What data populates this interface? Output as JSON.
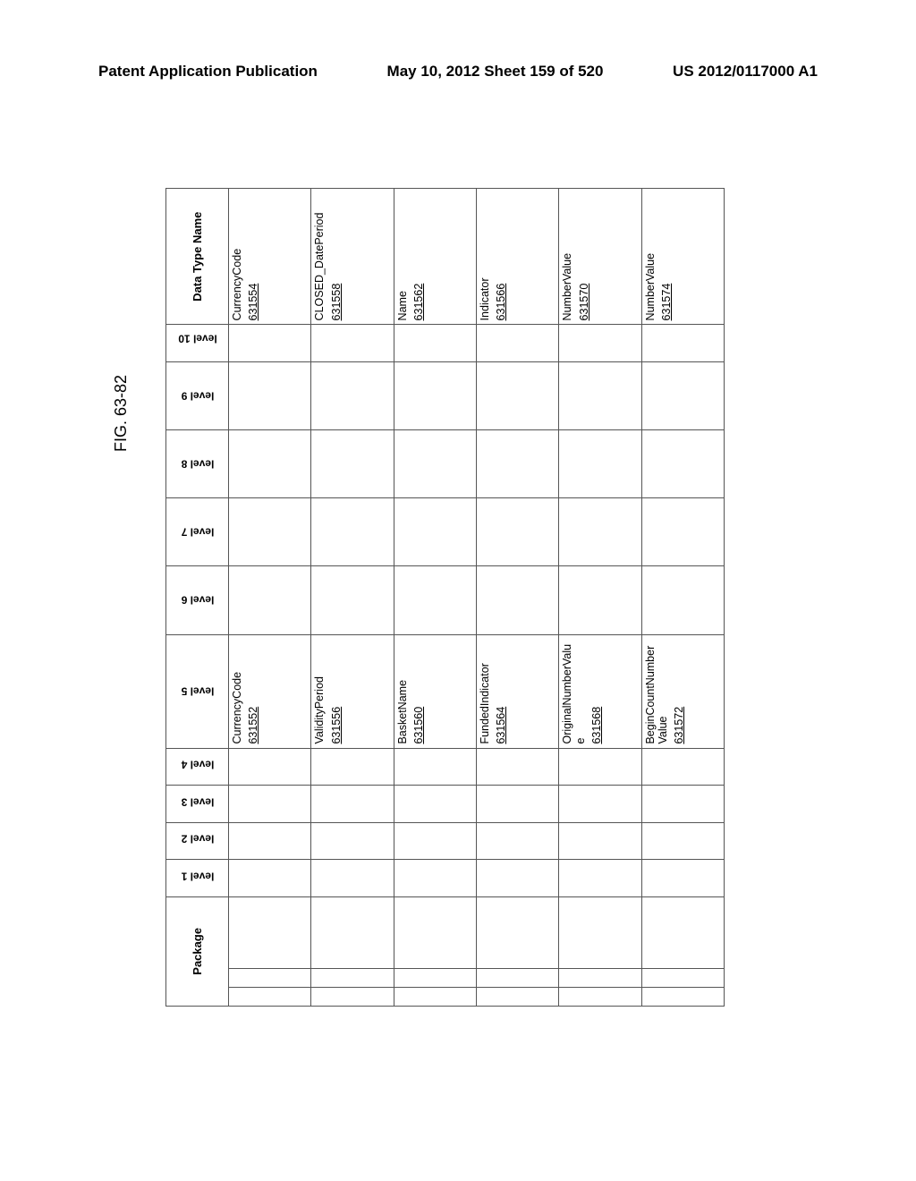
{
  "header": {
    "left": "Patent Application Publication",
    "center": "May 10, 2012  Sheet 159 of 520",
    "right": "US 2012/0117000 A1"
  },
  "figure_label": "FIG. 63-82",
  "columns": {
    "package": "Package",
    "level1": "level 1",
    "level2": "level 2",
    "level3": "level 3",
    "level4": "level 4",
    "level5": "level 5",
    "level6": "level 6",
    "level7": "level 7",
    "level8": "level 8",
    "level9": "level 9",
    "level10": "level 10",
    "datatype": "Data Type Name"
  },
  "rows": [
    {
      "level5": "CurrencyCode",
      "level5_ref": "631552",
      "datatype": "CurrencyCode",
      "datatype_ref": "631554"
    },
    {
      "level5": "ValidityPeriod",
      "level5_ref": "631556",
      "datatype": "CLOSED_DatePeriod",
      "datatype_ref": "631558"
    },
    {
      "level5": "BasketName",
      "level5_ref": "631560",
      "datatype": "Name",
      "datatype_ref": "631562"
    },
    {
      "level5": "FundedIndicator",
      "level5_ref": "631564",
      "datatype": "Indicator",
      "datatype_ref": "631566"
    },
    {
      "level5": "OriginalNumberValue",
      "level5_ref": "631568",
      "datatype": "NumberValue",
      "datatype_ref": "631570"
    },
    {
      "level5": "BeginCountNumberValue",
      "level5_ref": "631572",
      "datatype": "NumberValue",
      "datatype_ref": "631574"
    }
  ]
}
